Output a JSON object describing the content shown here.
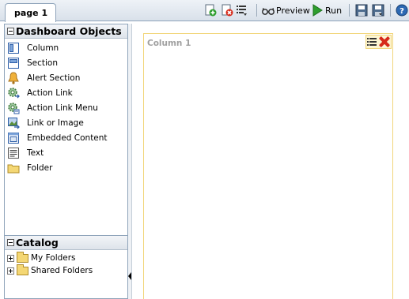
{
  "tabs": [
    {
      "label": "page 1"
    }
  ],
  "toolbar": {
    "preview_label": "Preview",
    "run_label": "Run"
  },
  "objects_panel": {
    "title": "Dashboard Objects",
    "items": [
      {
        "label": "Column",
        "icon": "column-icon"
      },
      {
        "label": "Section",
        "icon": "section-icon"
      },
      {
        "label": "Alert Section",
        "icon": "bell-icon"
      },
      {
        "label": "Action Link",
        "icon": "gear-link-icon"
      },
      {
        "label": "Action Link Menu",
        "icon": "gear-menu-icon"
      },
      {
        "label": "Link or Image",
        "icon": "image-link-icon"
      },
      {
        "label": "Embedded Content",
        "icon": "embedded-content-icon"
      },
      {
        "label": "Text",
        "icon": "text-icon"
      },
      {
        "label": "Folder",
        "icon": "folder-icon"
      }
    ]
  },
  "catalog_panel": {
    "title": "Catalog",
    "items": [
      {
        "label": "My Folders"
      },
      {
        "label": "Shared Folders"
      }
    ]
  },
  "canvas": {
    "column_title": "Column 1"
  },
  "colors": {
    "accent_border": "#8fa4ba",
    "column_border": "#f1d57a",
    "delete_red": "#d62a1a",
    "run_green": "#2e9e2e"
  }
}
